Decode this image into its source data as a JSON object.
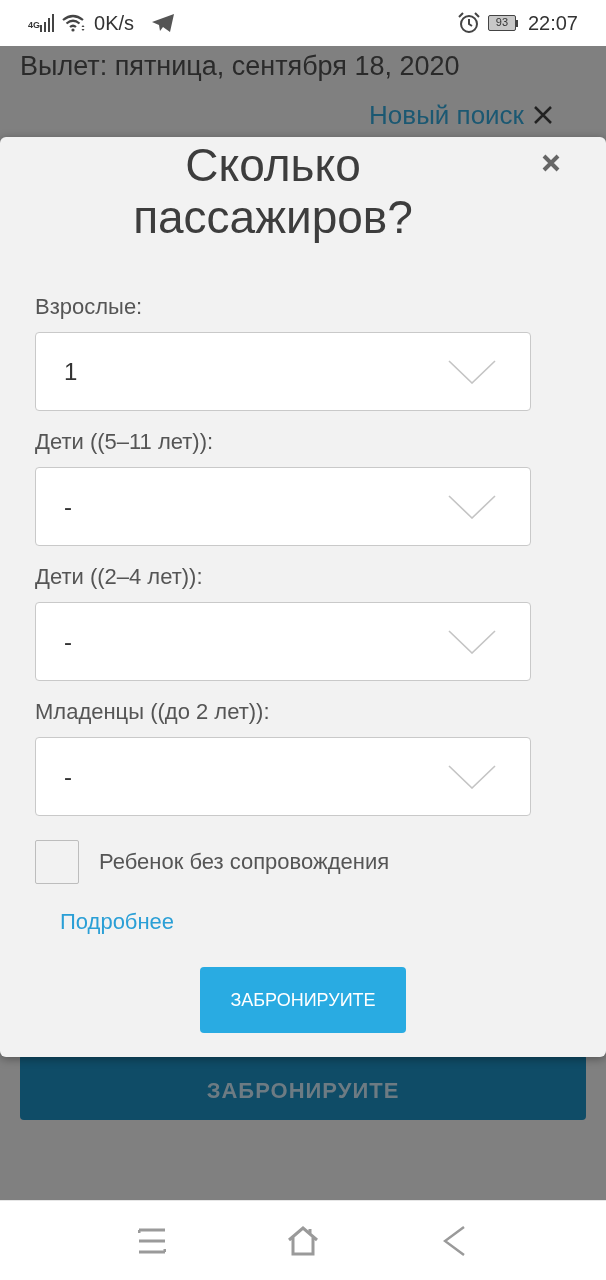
{
  "status_bar": {
    "network": "4G",
    "speed": "0K/s",
    "battery": "93",
    "time": "22:07"
  },
  "page": {
    "departure": "Вылет: пятница, сентября 18, 2020",
    "new_search_link": "Новый поиск",
    "book_button": "ЗАБРОНИРУИТЕ"
  },
  "modal": {
    "title": "Сколько пассажиров?",
    "fields": [
      {
        "label": "Взрослые:",
        "value": "1"
      },
      {
        "label": "Дети ((5–11 лет)):",
        "value": "-"
      },
      {
        "label": "Дети ((2–4 лет)):",
        "value": "-"
      },
      {
        "label": "Младенцы ((до 2 лет)):",
        "value": "-"
      }
    ],
    "unaccompanied": {
      "label": "Ребенок без сопровождения",
      "checked": false
    },
    "details_link": "Подробнее",
    "submit_button": "ЗАБРОНИРУИТЕ"
  }
}
